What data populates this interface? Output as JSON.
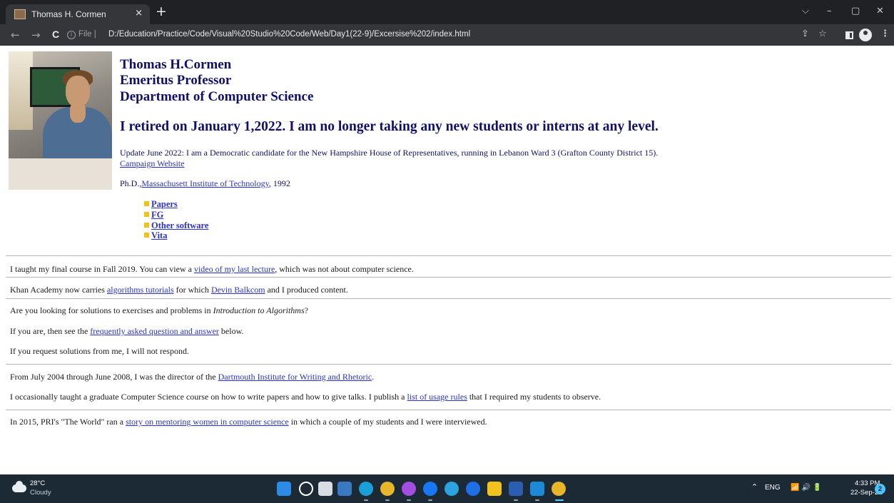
{
  "browser": {
    "tab_title": "Thomas H. Cormen",
    "tab_close": "×",
    "new_tab": "+",
    "window_controls": {
      "dropdown": "⌵",
      "minimize": "–",
      "maximize": "▢",
      "close": "✕"
    },
    "nav": {
      "back": "←",
      "forward": "→",
      "reload": "C"
    },
    "url_prefix": "File",
    "url_separator": "|",
    "url": "D:/Education/Practice/Code/Visual%20Studio%20Code/Web/Day1(22-9)/Excersise%202/index.html",
    "icons": {
      "share": "⇪",
      "bookmark": "☆",
      "menu": "⋮"
    }
  },
  "page": {
    "photo_alt": "Thomas H. Cormen",
    "name": "Thomas H.Cormen",
    "title": "Emeritus Professor",
    "department": "Department of Computer Science",
    "retired_notice": "I retired on January 1,2022. I am no longer taking any new students or interns at any level.",
    "update_text": "Update June 2022: I am a Democratic candidate for the New Hampshire House of Representatives, running in Lebanon Ward 3 (Grafton County District 15).",
    "campaign_link": "Campaign Website",
    "phd_prefix": "Ph.D.,",
    "phd_link": "Massachusett Institute of Technology",
    "phd_suffix": ", 1992",
    "menu": [
      "Papers",
      "FG",
      "Other software",
      "Vita"
    ],
    "sections": {
      "final_course": {
        "pre": "I taught my final course in Fall 2019. You can view a ",
        "link": "video of my last lecture",
        "post": ", which was not about computer science."
      },
      "khan": {
        "pre": "Khan Academy now carries ",
        "link1": "algorithms tutorials",
        "mid": " for which ",
        "link2": "Devin Balkcom",
        "post": " and I produced content."
      },
      "solutions_q": {
        "pre": "Are you looking for solutions to exercises and problems in ",
        "em": "Introduction to Algorithms",
        "post": "?"
      },
      "solutions_faq": {
        "pre": "If you are, then see the ",
        "link": "frequently asked question and answer",
        "post": " below."
      },
      "solutions_no": "If you request solutions from me, I will not respond.",
      "dartmouth": {
        "pre": "From July 2004 through June 2008, I was the director of the ",
        "link": "Dartmouth Institute for Writing and Rhetoric",
        "post": "."
      },
      "grad_course": {
        "pre": "I occasionally taught a graduate Computer Science course on how to write papers and how to give talks. I publish a ",
        "link": "list of usage rules",
        "post": " that I required my students to observe."
      },
      "pri": {
        "pre": "In 2015, PRI's \"The World\" ran a ",
        "link": "story on mentoring women in computer science",
        "post": " in which a couple of my students and I were interviewed."
      }
    }
  },
  "taskbar": {
    "temperature": "28°C",
    "condition": "Cloudy",
    "apps": [
      "windows-start",
      "search",
      "task-view",
      "widgets",
      "edge",
      "chrome",
      "messenger",
      "facebook",
      "telegram",
      "zalo",
      "file-explorer",
      "word",
      "vscode",
      "chrome-active"
    ],
    "tray_chevron": "⌃",
    "language": "ENG",
    "tray_icons": "📶 🔊 🔋",
    "time": "4:33 PM",
    "date": "22-Sep-22",
    "notification_count": "2"
  }
}
